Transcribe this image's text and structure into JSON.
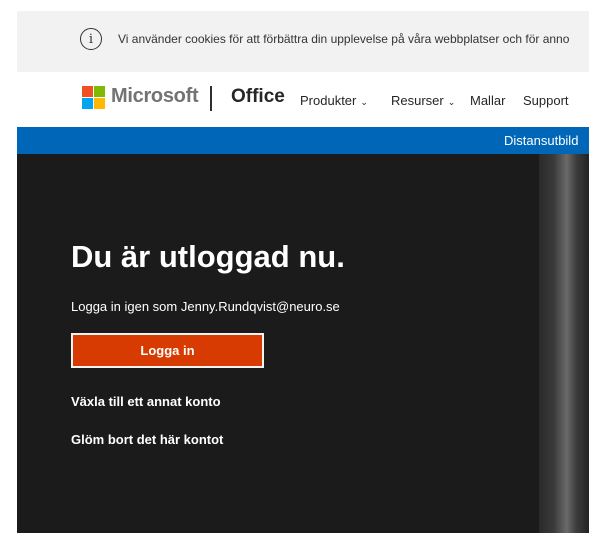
{
  "cookie_banner": {
    "icon": "info-icon",
    "text": "Vi använder cookies för att förbättra din upplevelse på våra webbplatser och för anno"
  },
  "header": {
    "brand": "Microsoft",
    "product": "Office",
    "nav": [
      {
        "label": "Produkter",
        "has_dropdown": true
      },
      {
        "label": "Resurser",
        "has_dropdown": true
      },
      {
        "label": "Mallar",
        "has_dropdown": false
      },
      {
        "label": "Support",
        "has_dropdown": false
      }
    ],
    "chevron": "⌄"
  },
  "announcement": {
    "text": "Distansutbild"
  },
  "hero": {
    "title": "Du är utloggad nu.",
    "subtitle": "Logga in igen som Jenny.Rundqvist@neuro.se",
    "login_button": "Logga in",
    "switch_account": "Växla till ett annat konto",
    "forget_account": "Glöm bort det här kontot"
  },
  "colors": {
    "accent_button": "#d83b01",
    "announcement_bar": "#0067b8",
    "hero_background": "#1b1b1b",
    "cookie_bar": "#f2f2f2"
  }
}
